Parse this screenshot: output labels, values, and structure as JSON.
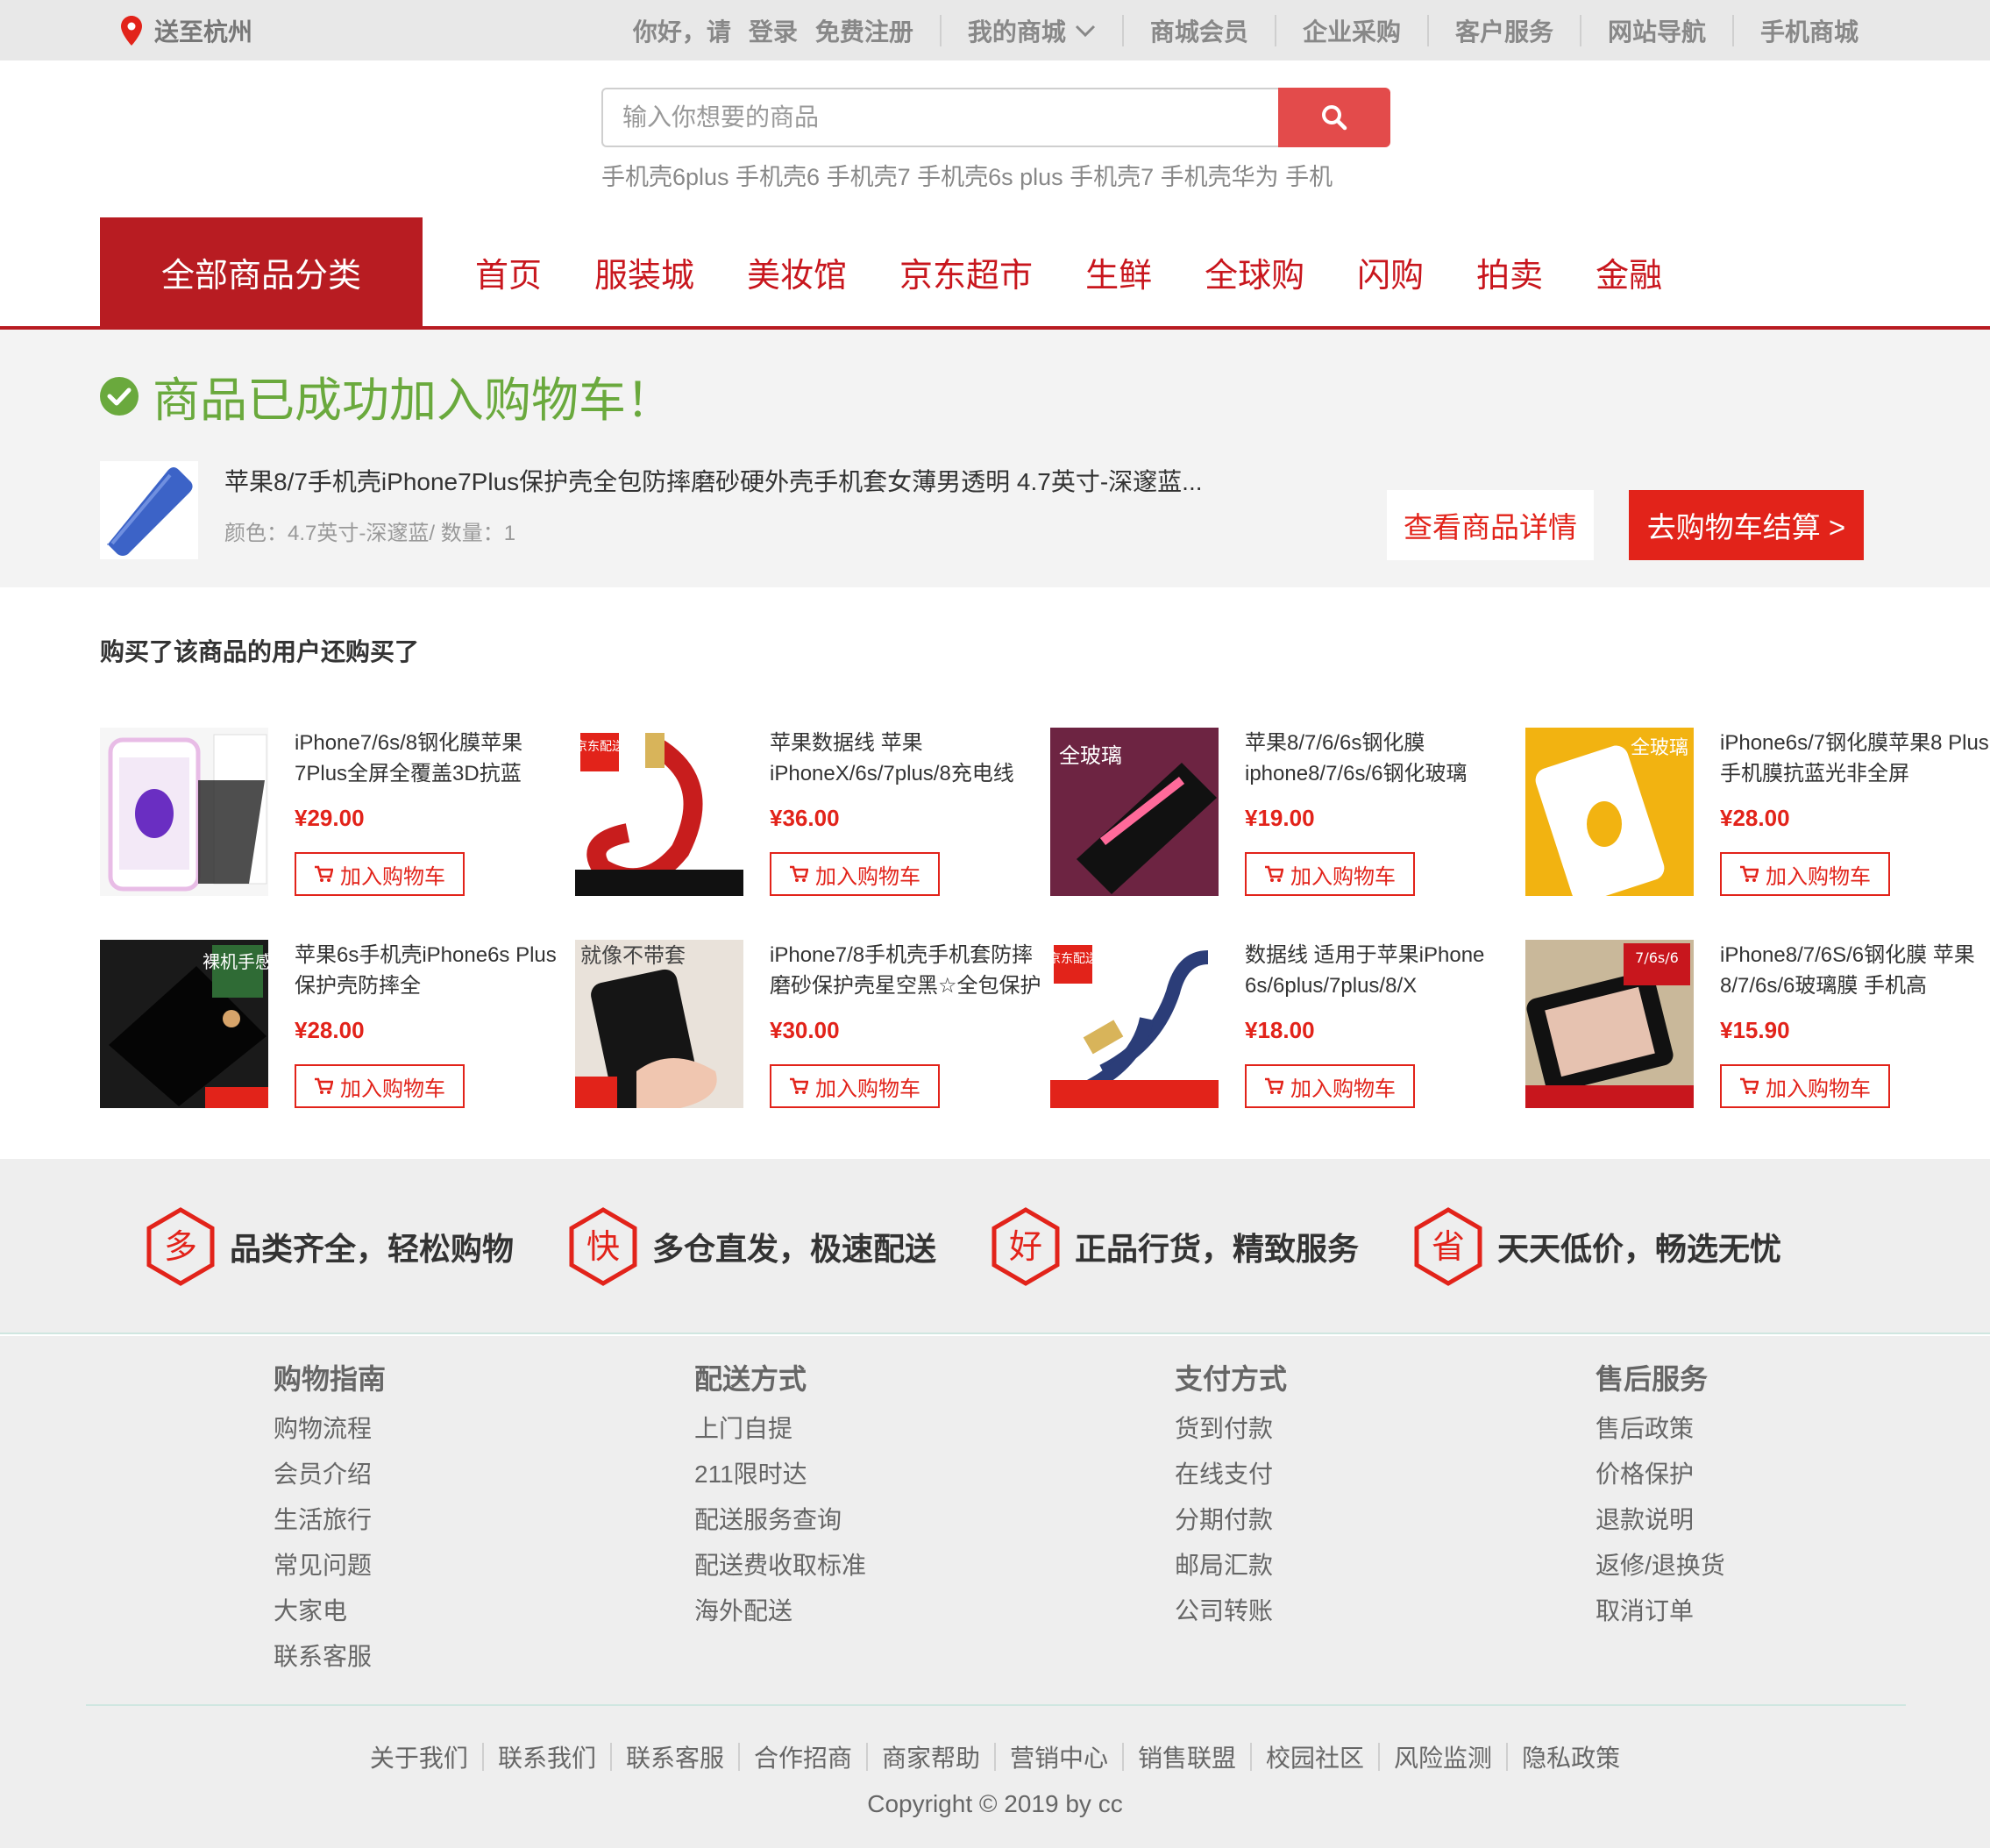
{
  "topbar": {
    "location": "送至杭州",
    "greeting": "你好，请",
    "login": "登录",
    "register": "免费注册",
    "my_mall": "我的商城",
    "links": [
      "商城会员",
      "企业采购",
      "客户服务",
      "网站导航",
      "手机商城"
    ]
  },
  "search": {
    "placeholder": "输入你想要的商品",
    "hotwords": "手机壳6plus  手机壳6  手机壳7  手机壳6s plus  手机壳7  手机壳华为  手机"
  },
  "nav": {
    "category": "全部商品分类",
    "items": [
      "首页",
      "服装城",
      "美妆馆",
      "京东超市",
      "生鲜",
      "全球购",
      "闪购",
      "拍卖",
      "金融"
    ]
  },
  "success": {
    "title": "商品已成功加入购物车！",
    "product_name": "苹果8/7手机壳iPhone7Plus保护壳全包防摔磨砂硬外壳手机套女薄男透明 4.7英寸-深邃蓝...",
    "product_meta": "颜色：4.7英寸-深邃蓝/ 数量：1",
    "view_detail": "查看商品详情",
    "checkout": "去购物车结算 >"
  },
  "recommend": {
    "title": "购买了该商品的用户还购买了",
    "add_label": "加入购物车",
    "items": [
      {
        "name": "iPhone7/6s/8钢化膜苹果7Plus全屏全覆盖3D抗蓝",
        "price": "¥29.00",
        "badge": ""
      },
      {
        "name": "苹果数据线 苹果iPhoneX/6s/7plus/8充电线",
        "price": "¥36.00",
        "badge": "京东配送"
      },
      {
        "name": "苹果8/7/6/6s钢化膜iphone8/7/6s/6钢化玻璃",
        "price": "¥19.00",
        "badge": "全玻璃"
      },
      {
        "name": "iPhone6s/7钢化膜苹果8 Plus手机膜抗蓝光非全屏",
        "price": "¥28.00",
        "badge": "全玻璃"
      },
      {
        "name": "苹果6s手机壳iPhone6s Plus保护壳防摔全",
        "price": "¥28.00",
        "badge": "裸机手感"
      },
      {
        "name": "iPhone7/8手机壳手机套防摔磨砂保护壳星空黑☆全包保护",
        "price": "¥30.00",
        "badge": "就像不带套"
      },
      {
        "name": "数据线 适用于苹果iPhone 6s/6plus/7plus/8/X",
        "price": "¥18.00",
        "badge": "京东配送"
      },
      {
        "name": "iPhone8/7/6S/6钢化膜 苹果8/7/6s/6玻璃膜 手机高",
        "price": "¥15.90",
        "badge": "7/6s/6"
      }
    ]
  },
  "promises": [
    {
      "icon": "多",
      "text": "品类齐全，轻松购物"
    },
    {
      "icon": "快",
      "text": "多仓直发，极速配送"
    },
    {
      "icon": "好",
      "text": "正品行货，精致服务"
    },
    {
      "icon": "省",
      "text": "天天低价，畅选无忧"
    }
  ],
  "footer": {
    "columns": [
      {
        "title": "购物指南",
        "items": [
          "购物流程",
          "会员介绍",
          "生活旅行",
          "常见问题",
          "大家电",
          "联系客服"
        ]
      },
      {
        "title": "配送方式",
        "items": [
          "上门自提",
          "211限时达",
          "配送服务查询",
          "配送费收取标准",
          "海外配送"
        ]
      },
      {
        "title": "支付方式",
        "items": [
          "货到付款",
          "在线支付",
          "分期付款",
          "邮局汇款",
          "公司转账"
        ]
      },
      {
        "title": "售后服务",
        "items": [
          "售后政策",
          "价格保护",
          "退款说明",
          "返修/退换货",
          "取消订单"
        ]
      }
    ],
    "links": [
      "关于我们",
      "联系我们",
      "联系客服",
      "合作招商",
      "商家帮助",
      "营销中心",
      "销售联盟",
      "校园社区",
      "风险监测",
      "隐私政策"
    ],
    "copyright": "Copyright © 2019 by cc"
  },
  "colors": {
    "brand_red": "#b81c22",
    "accent_red": "#e2231a",
    "success_green": "#6aa93d"
  }
}
